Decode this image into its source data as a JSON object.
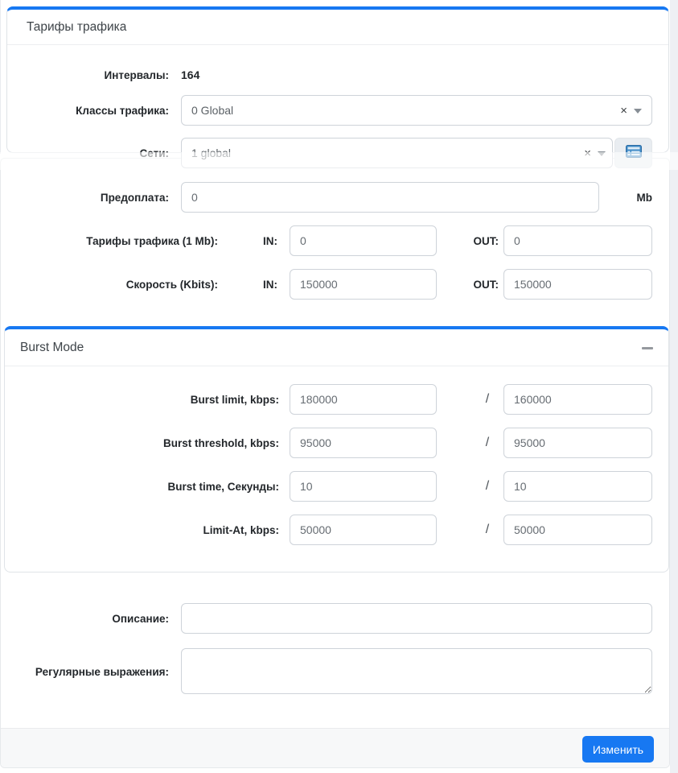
{
  "colors": {
    "accent": "#1778f2",
    "icon_blue": "#3e8ac6",
    "footer_bg": "#f7f8f9"
  },
  "tariff_card": {
    "title": "Тарифы трафика",
    "intervals_label": "Интервалы:",
    "intervals_value": "164",
    "classes_label": "Классы трафика:",
    "classes_value": "0 Global",
    "networks_label": "Сети:",
    "networks_value": "1 global",
    "clear_glyph": "×"
  },
  "form": {
    "prepaid_label": "Предоплата:",
    "prepaid_value": "0",
    "prepaid_unit": "Mb",
    "tariff_label": "Тарифы трафика (1 Mb):",
    "tariff_in": "0",
    "tariff_out": "0",
    "speed_label": "Скорость (Kbits):",
    "speed_in": "150000",
    "speed_out": "150000",
    "in_label": "IN:",
    "out_label": "OUT:"
  },
  "burst": {
    "title": "Burst Mode",
    "separator": "/",
    "rows": [
      {
        "label": "Burst limit, kbps:",
        "in": "180000",
        "out": "160000"
      },
      {
        "label": "Burst threshold, kbps:",
        "in": "95000",
        "out": "95000"
      },
      {
        "label": "Burst time, Секунды:",
        "in": "10",
        "out": "10"
      },
      {
        "label": "Limit-At, kbps:",
        "in": "50000",
        "out": "50000"
      }
    ]
  },
  "bottom": {
    "description_label": "Описание:",
    "description_value": "",
    "regex_label": "Регулярные выражения:",
    "regex_value": ""
  },
  "footer": {
    "submit_label": "Изменить"
  }
}
